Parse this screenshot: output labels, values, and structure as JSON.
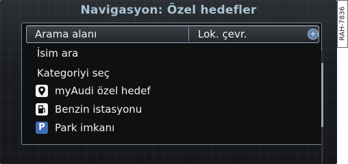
{
  "window": {
    "title": "Navigasyon: Özel hedefler"
  },
  "menu": {
    "search_area": {
      "label": "Arama alanı",
      "value": "Lok. çevr.",
      "plus": "+"
    },
    "search_name": "İsim ara",
    "select_category": "Kategoriyi seç",
    "categories": [
      {
        "label": "myAudi özel hedef",
        "icon": "location-pin-icon"
      },
      {
        "label": "Benzin istasyonu",
        "icon": "fuel-pump-icon"
      },
      {
        "label": "Park imkanı",
        "icon": "parking-icon",
        "icon_text": "P"
      }
    ]
  },
  "figure_code": "RAH-7836",
  "colors": {
    "title": "#a9c3d3",
    "accent": "#5e84a8",
    "parking": "#3d6fb5"
  }
}
